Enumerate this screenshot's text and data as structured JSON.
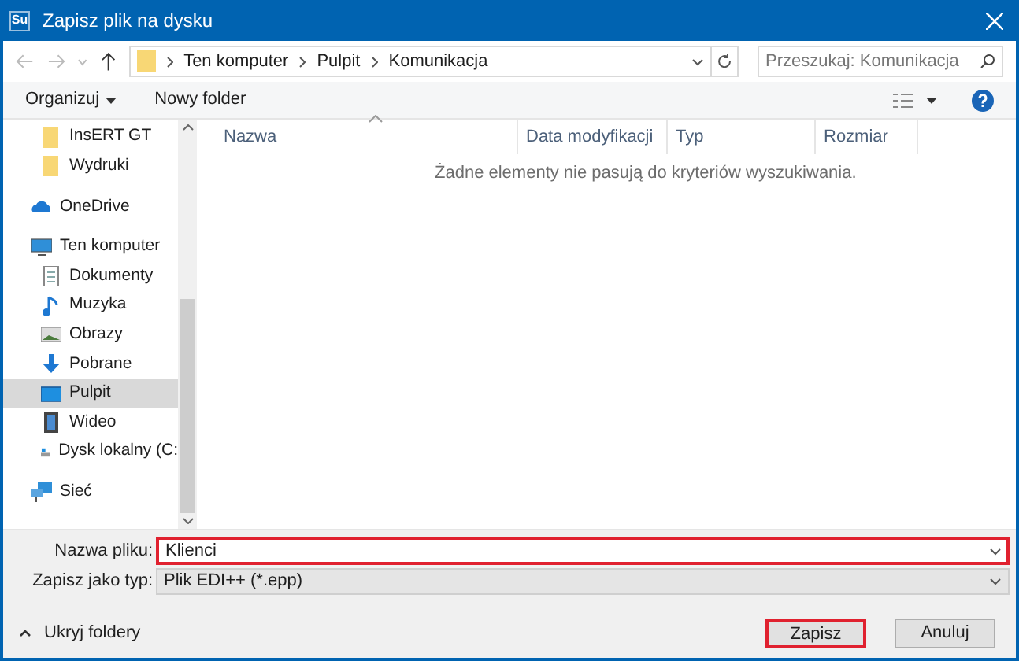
{
  "window": {
    "app_badge": "Su",
    "title": "Zapisz plik na dysku"
  },
  "address": {
    "path": [
      "Ten komputer",
      "Pulpit",
      "Komunikacja"
    ],
    "search_placeholder": "Przeszukaj: Komunikacja"
  },
  "toolbar": {
    "organize": "Organizuj",
    "new_folder": "Nowy folder"
  },
  "sidebar": {
    "partial_children": [
      {
        "label": "InsERT GT",
        "selected": false
      },
      {
        "label": "Wydruki",
        "selected": false
      }
    ],
    "items": [
      {
        "label": "OneDrive",
        "selected": false
      },
      {
        "label": "Ten komputer",
        "selected": false,
        "children": [
          {
            "label": "Dokumenty",
            "selected": false
          },
          {
            "label": "Muzyka",
            "selected": false
          },
          {
            "label": "Obrazy",
            "selected": false
          },
          {
            "label": "Pobrane",
            "selected": false
          },
          {
            "label": "Pulpit",
            "selected": true
          },
          {
            "label": "Wideo",
            "selected": false
          },
          {
            "label": "Dysk lokalny (C:",
            "selected": false
          }
        ]
      },
      {
        "label": "Sieć",
        "selected": false
      }
    ]
  },
  "table": {
    "columns": [
      "Nazwa",
      "Data modyfikacji",
      "Typ",
      "Rozmiar"
    ],
    "empty_message": "Żadne elementy nie pasują do kryteriów wyszukiwania."
  },
  "form": {
    "filename_label": "Nazwa pliku:",
    "filename": "Klienci",
    "filename_highlighted": true,
    "type_label": "Zapisz jako typ:",
    "type": "Plik EDI++ (*.epp)"
  },
  "footer": {
    "hide_folders": "Ukryj foldery",
    "buttons": [
      {
        "label": "Zapisz",
        "highlighted": true
      },
      {
        "label": "Anuluj",
        "highlighted": false
      }
    ]
  }
}
